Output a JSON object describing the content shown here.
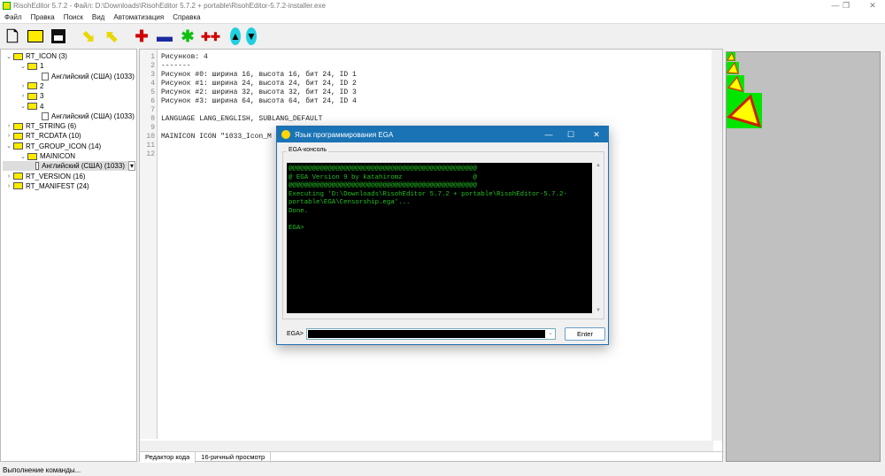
{
  "window": {
    "title": "RisohEditor 5.7.2 - Файл: D:\\Downloads\\RisohEditor 5.7.2 + portable\\RisohEditor-5.7.2-installer.exe"
  },
  "menu": [
    "Файл",
    "Правка",
    "Поиск",
    "Вид",
    "Автоматизация",
    "Справка"
  ],
  "toolbar": [
    "new-file",
    "open-folder",
    "save",
    "import",
    "export",
    "add",
    "delete",
    "edit",
    "clone",
    "move-up",
    "move-down"
  ],
  "tree": [
    {
      "label": "RT_ICON (3)",
      "level": 0,
      "exp": "v"
    },
    {
      "label": "1",
      "level": 1,
      "exp": "v"
    },
    {
      "label": "Английский (США) (1033)",
      "level": 2,
      "leaf": true
    },
    {
      "label": "2",
      "level": 1,
      "exp": ">"
    },
    {
      "label": "3",
      "level": 1,
      "exp": ">"
    },
    {
      "label": "4",
      "level": 1,
      "exp": "v"
    },
    {
      "label": "Английский (США) (1033)",
      "level": 2,
      "leaf": true
    },
    {
      "label": "RT_STRING (6)",
      "level": 0,
      "exp": ">"
    },
    {
      "label": "RT_RCDATA (10)",
      "level": 0,
      "exp": ">"
    },
    {
      "label": "RT_GROUP_ICON (14)",
      "level": 0,
      "exp": "v"
    },
    {
      "label": "MAINICON",
      "level": 1,
      "exp": "v"
    },
    {
      "label": "Английский (США) (1033)",
      "level": 2,
      "leaf": true,
      "selected": true
    },
    {
      "label": "RT_VERSION (16)",
      "level": 0,
      "exp": ">"
    },
    {
      "label": "RT_MANIFEST (24)",
      "level": 0,
      "exp": ">"
    }
  ],
  "editor": {
    "lines": [
      "Рисунков: 4",
      "-------",
      "Рисунок #0: ширина 16, высота 16, бит 24, ID 1",
      "Рисунок #1: ширина 24, высота 24, бит 24, ID 2",
      "Рисунок #2: ширина 32, высота 32, бит 24, ID 3",
      "Рисунок #3: ширина 64, высота 64, бит 24, ID 4",
      "",
      "LANGUAGE LANG_ENGLISH, SUBLANG_DEFAULT",
      "",
      "MAINICON ICON \"1033_Icon_M",
      "",
      ""
    ],
    "tabs": [
      "Редактор кода",
      "16-ричный просмотр"
    ]
  },
  "status": "Выполнение команды...",
  "dialog": {
    "title": "Язык программирования EGA",
    "group_label": "EGA-консоль",
    "console": "@@@@@@@@@@@@@@@@@@@@@@@@@@@@@@@@@@@@@@@@@@@@@@@@\n@ EGA Version 9 by katahiromz                  @\n@@@@@@@@@@@@@@@@@@@@@@@@@@@@@@@@@@@@@@@@@@@@@@@@\nExecuting 'D:\\Downloads\\RisohEditor 5.7.2 + portable\\RisohEditor-5.7.2-\nportable\\EGA\\Censorship.ega'...\nDone.\n\nEGA>",
    "input_label": "EGA>",
    "input_value": "",
    "enter_label": "Enter"
  },
  "colors": {
    "console_text": "#22c022",
    "title_accent": "#1a73b5"
  }
}
